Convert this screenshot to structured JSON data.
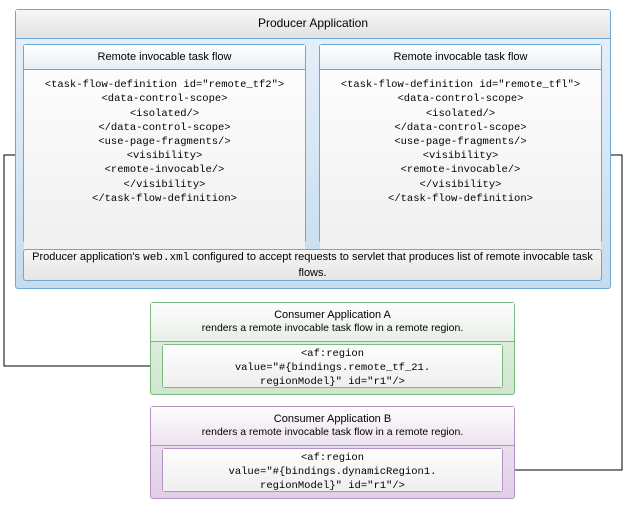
{
  "producer": {
    "title": "Producer Application",
    "tf_left": {
      "title": "Remote invocable task flow",
      "code": "<task-flow-definition id=\"remote_tf2\">\n  <data-control-scope>\n    <isolated/>\n  </data-control-scope>\n  <use-page-fragments/>\n    <visibility>\n  <remote-invocable/>\n    </visibility>\n  </task-flow-definition>"
    },
    "tf_right": {
      "title": "Remote invocable task flow",
      "code": "<task-flow-definition id=\"remote_tfl\">\n  <data-control-scope>\n    <isolated/>\n  </data-control-scope>\n  <use-page-fragments/>\n    <visibility>\n  <remote-invocable/>\n    </visibility>\n  </task-flow-definition>"
    },
    "note_pre": "Producer application's ",
    "note_mono": "web.xml",
    "note_post": " configured to accept requests to servlet that produces list of remote invocable task flows."
  },
  "consumerA": {
    "title": "Consumer Application A",
    "subtitle": "renders a remote invocable task flow in a remote region.",
    "region_code": "<af:region\nvalue=\"#{bindings.remote_tf_21.\nregionModel}\" id=\"r1\"/>"
  },
  "consumerB": {
    "title": "Consumer Application B",
    "subtitle": "renders a remote invocable task flow in a remote region.",
    "region_code": "<af:region\nvalue=\"#{bindings.dynamicRegion1.\nregionModel}\" id=\"r1\"/>"
  }
}
